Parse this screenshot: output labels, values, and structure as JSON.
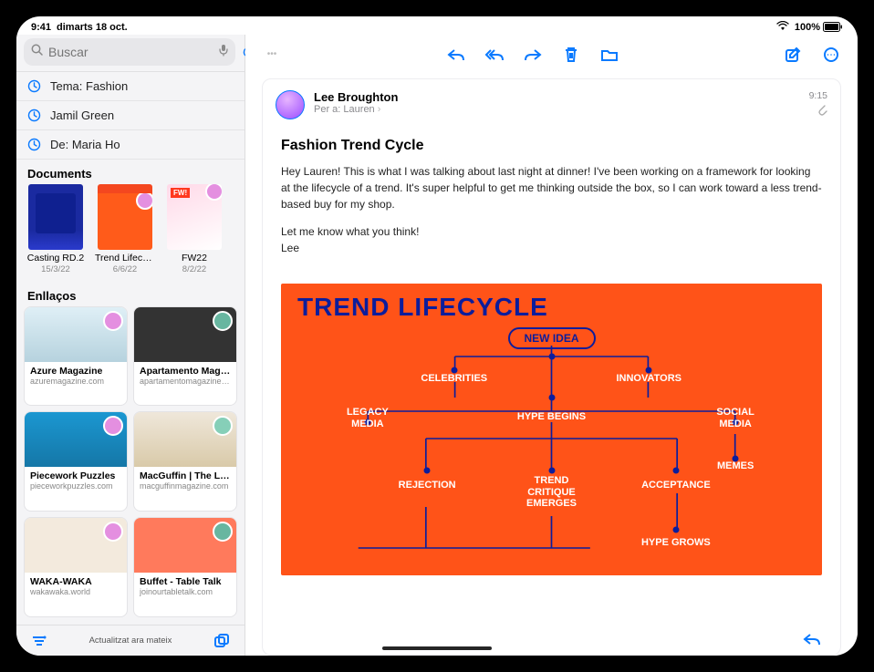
{
  "status": {
    "time": "9:41",
    "date": "dimarts 18 oct.",
    "wifi": "wifi-icon",
    "battery_pct": "100%"
  },
  "search": {
    "placeholder": "Buscar",
    "cancel": "Cancel·lar"
  },
  "suggestions": [
    {
      "label": "Tema: Fashion"
    },
    {
      "label": "Jamil Green"
    },
    {
      "label": "De: Maria Ho"
    }
  ],
  "docs_header": "Documents",
  "documents": [
    {
      "name": "Casting RD.2",
      "date": "15/3/22"
    },
    {
      "name": "Trend Lifecycle",
      "date": "6/6/22"
    },
    {
      "name": "FW22",
      "date": "8/2/22"
    }
  ],
  "links_header": "Enllaços",
  "links": [
    {
      "title": "Azure Magazine",
      "domain": "azuremagazine.com"
    },
    {
      "title": "Apartamento Maga...",
      "domain": "apartamentomagazine.c..."
    },
    {
      "title": "Piecework Puzzles",
      "domain": "pieceworkpuzzles.com"
    },
    {
      "title": "MacGuffin | The Lif...",
      "domain": "macguffinmagazine.com"
    },
    {
      "title": "WAKA-WAKA",
      "domain": "wakawaka.world"
    },
    {
      "title": "Buffet - Table Talk",
      "domain": "joinourtabletalk.com"
    }
  ],
  "sidebar_footer": {
    "status": "Actualitzat ara mateix"
  },
  "email": {
    "sender": "Lee Broughton",
    "recipients_prefix": "Per a:",
    "recipient": "Lauren",
    "time": "9:15",
    "subject": "Fashion Trend Cycle",
    "body_p1": "Hey Lauren! This is what I was talking about last night at dinner! I've been working on a framework for looking at the lifecycle of a trend. It's super helpful to get me thinking outside the box, so I can work toward a less trend-based buy for my shop.",
    "body_p2": "Let me know what you think!",
    "body_p3": "Lee"
  },
  "attachment": {
    "title": "TREND LIFECYCLE",
    "chip_new_idea": "NEW IDEA",
    "nodes": {
      "celebrities": "CELEBRITIES",
      "innovators": "INNOVATORS",
      "legacy": "LEGACY\nMEDIA",
      "hype_begins": "HYPE BEGINS",
      "social": "SOCIAL\nMEDIA",
      "memes": "MEMES",
      "rejection": "REJECTION",
      "critique": "TREND\nCRITIQUE\nEMERGES",
      "acceptance": "ACCEPTANCE",
      "hype_grows": "HYPE GROWS"
    }
  }
}
